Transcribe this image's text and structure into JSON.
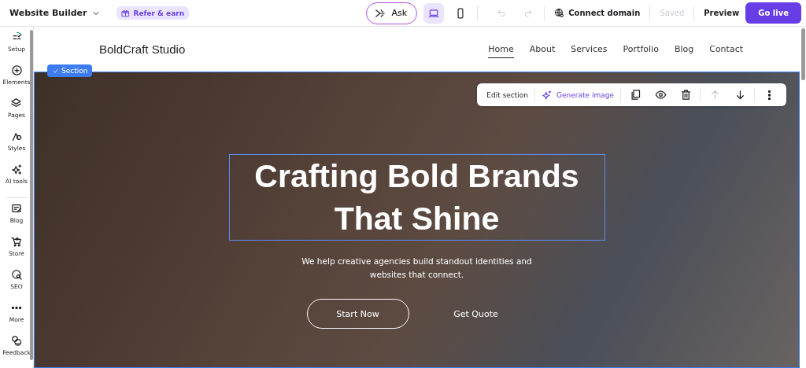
{
  "top_bar": {
    "product": "Website Builder",
    "refer": "Refer & earn",
    "ask": "Ask",
    "devices": [
      {
        "kind": "desktop",
        "selected": true
      },
      {
        "kind": "mobile",
        "selected": false
      }
    ],
    "history": [
      {
        "kind": "undo",
        "disabled": true
      },
      {
        "kind": "redo",
        "disabled": true
      }
    ],
    "connect": "Connect domain",
    "saved": {
      "label": "Saved",
      "disabled": true
    },
    "preview": "Preview",
    "go_live": "Go live"
  },
  "sidebar": {
    "items": [
      {
        "kind": "setup",
        "label": "Setup"
      },
      {
        "kind": "elements",
        "label": "Elements"
      },
      {
        "kind": "pages",
        "label": "Pages"
      },
      {
        "kind": "styles",
        "label": "Styles"
      },
      {
        "kind": "ai",
        "label": "AI tools"
      },
      {
        "kind": "blog",
        "label": "Blog"
      },
      {
        "kind": "store",
        "label": "Store"
      },
      {
        "kind": "seo",
        "label": "SEO"
      },
      {
        "kind": "more",
        "label": "More"
      },
      {
        "kind": "feedback",
        "label": "Feedback"
      }
    ]
  },
  "site_header": {
    "logo": "BoldCraft Studio",
    "nav": [
      {
        "label": "Home",
        "selected": true
      },
      {
        "label": "About",
        "selected": false
      },
      {
        "label": "Services",
        "selected": false
      },
      {
        "label": "Portfolio",
        "selected": false
      },
      {
        "label": "Blog",
        "selected": false
      },
      {
        "label": "Contact",
        "selected": false
      }
    ]
  },
  "section_label": "Section",
  "section_toolbar": {
    "edit": "Edit section",
    "generate": "Generate image",
    "actions": [
      {
        "kind": "duplicate",
        "disabled": false
      },
      {
        "kind": "visibility",
        "disabled": false
      },
      {
        "kind": "delete",
        "disabled": false
      },
      {
        "kind": "move_up",
        "disabled": true
      },
      {
        "kind": "move_down",
        "disabled": false
      },
      {
        "kind": "more",
        "disabled": false
      }
    ]
  },
  "hero": {
    "heading_lines": [
      "Crafting Bold Brands",
      "That Shine"
    ],
    "subtitle": "We help creative agencies build standout identities and websites that connect.",
    "buttons": [
      {
        "kind": "outline",
        "label": "Start Now"
      },
      {
        "kind": "text",
        "label": "Get Quote"
      }
    ]
  }
}
